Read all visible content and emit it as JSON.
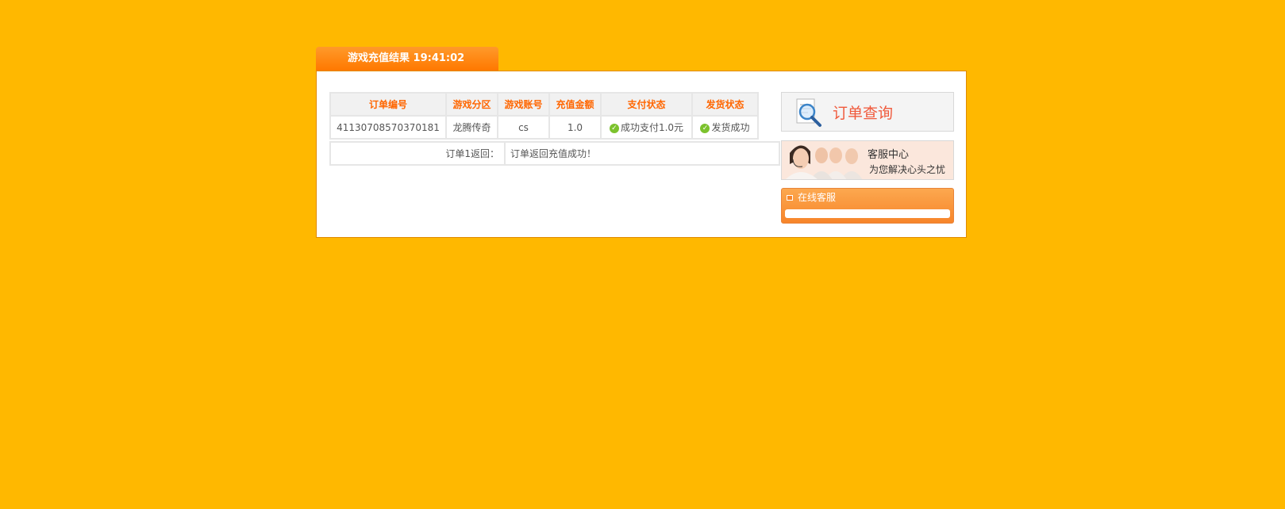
{
  "header": {
    "title": "游戏充值结果 19:41:02"
  },
  "order_table": {
    "columns": [
      "订单编号",
      "游戏分区",
      "游戏账号",
      "充值金额",
      "支付状态",
      "发货状态"
    ],
    "rows": [
      {
        "order_no": "41130708570370181",
        "zone": "龙腾传奇",
        "account": "cs",
        "amount": "1.0",
        "pay_status": "成功支付1.0元",
        "ship_status": "发货成功"
      }
    ]
  },
  "result": {
    "label": "订单1返回：",
    "value": "订单返回充值成功！"
  },
  "sidebar": {
    "query_label": "订单查询",
    "service_title": "客服中心",
    "service_subtitle": "为您解决心头之忧",
    "online_label": "在线客服"
  },
  "icons": {
    "status_check": "check-circle-icon",
    "query": "magnifier-document-icon"
  },
  "colors": {
    "page_background": "#ffb800",
    "tab_orange": "#ff7800",
    "header_text": "#ff6600",
    "check_green": "#7cc22d",
    "query_text": "#f05a3c"
  }
}
